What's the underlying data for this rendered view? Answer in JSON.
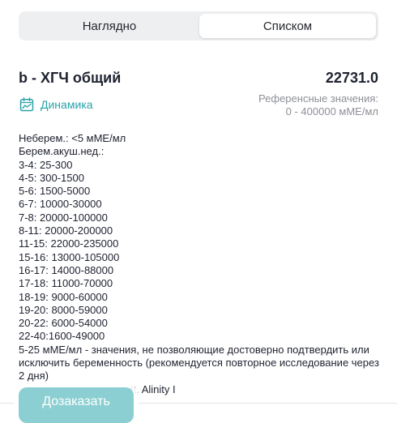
{
  "view_switch": {
    "tabs": [
      {
        "label": "Наглядно",
        "active": false
      },
      {
        "label": "Списком",
        "active": true
      }
    ]
  },
  "test": {
    "name": "b - ХГЧ общий",
    "value": "22731.0",
    "dynamics_label": "Динамика",
    "dynamics_icon": "chart-calendar-icon",
    "reference_title": "Референсные значения:",
    "reference_range": "0 - 400000 мМЕ/мл",
    "description_lines": [
      "Неберем.: <5 мМЕ/мл",
      "Берем.акуш.нед.:",
      "3-4: 25-300",
      "4-5: 300-1500",
      "5-6: 1500-5000",
      "6-7: 10000-30000",
      "7-8: 20000-100000",
      "8-11: 20000-200000",
      "11-15: 22000-235000",
      "15-16: 13000-105000",
      "16-17: 14000-88000",
      "17-18: 11000-70000",
      "18-19: 9000-60000",
      "19-20: 8000-59000",
      "20-22: 6000-54000",
      "22-40:1600-49000"
    ],
    "description_note": "5-25 мМЕ/мл - значения, не позволяющие достоверно подтвердить или исключить беременность (рекомендуется повторное исследование через 2 дня)",
    "description_tail": "tt, Alinity I"
  },
  "actions": {
    "order_button": "Дозаказать"
  },
  "colors": {
    "accent": "#2aa3a9",
    "button_bg": "#8ccfd2",
    "muted_text": "#8d9098"
  }
}
